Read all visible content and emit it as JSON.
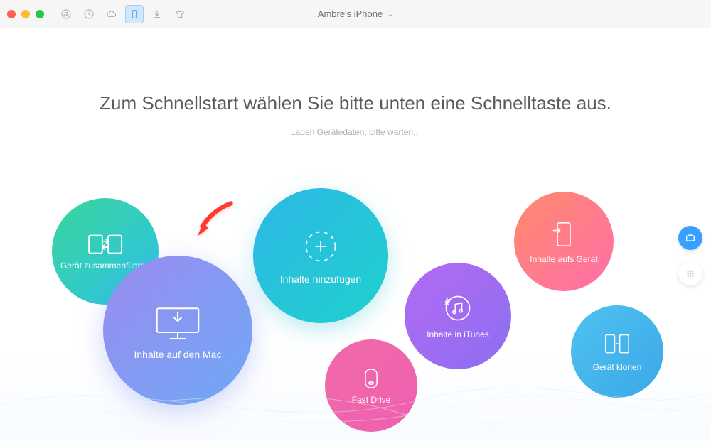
{
  "toolbar": {
    "device_title": "Ambre's iPhone"
  },
  "main": {
    "headline": "Zum Schnellstart wählen Sie bitte unten eine Schnelltaste aus.",
    "subline": "Laden Gerätedaten, bitte warten..."
  },
  "circles": {
    "merge": {
      "label": "Gerät zusammenführen"
    },
    "mac": {
      "label": "Inhalte auf den Mac"
    },
    "add": {
      "label": "Inhalte hinzufügen"
    },
    "fast": {
      "label": "Fast Drive"
    },
    "itunes": {
      "label": "Inhalte in iTunes"
    },
    "device": {
      "label": "Inhalte aufs Gerät"
    },
    "clone": {
      "label": "Gerät klonen"
    }
  }
}
